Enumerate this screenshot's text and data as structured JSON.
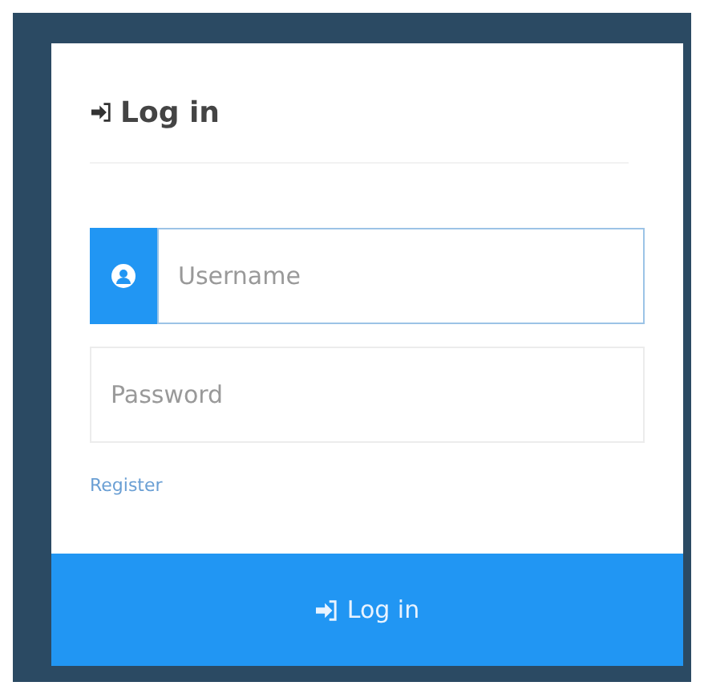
{
  "panel": {
    "title": "Log in"
  },
  "fields": [
    {
      "kind": "icon",
      "placeholder": "Username",
      "focused": true
    },
    {
      "kind": "plain",
      "placeholder": "Password",
      "focused": false
    }
  ],
  "register_link": "Register",
  "submit_button": "Log in"
}
